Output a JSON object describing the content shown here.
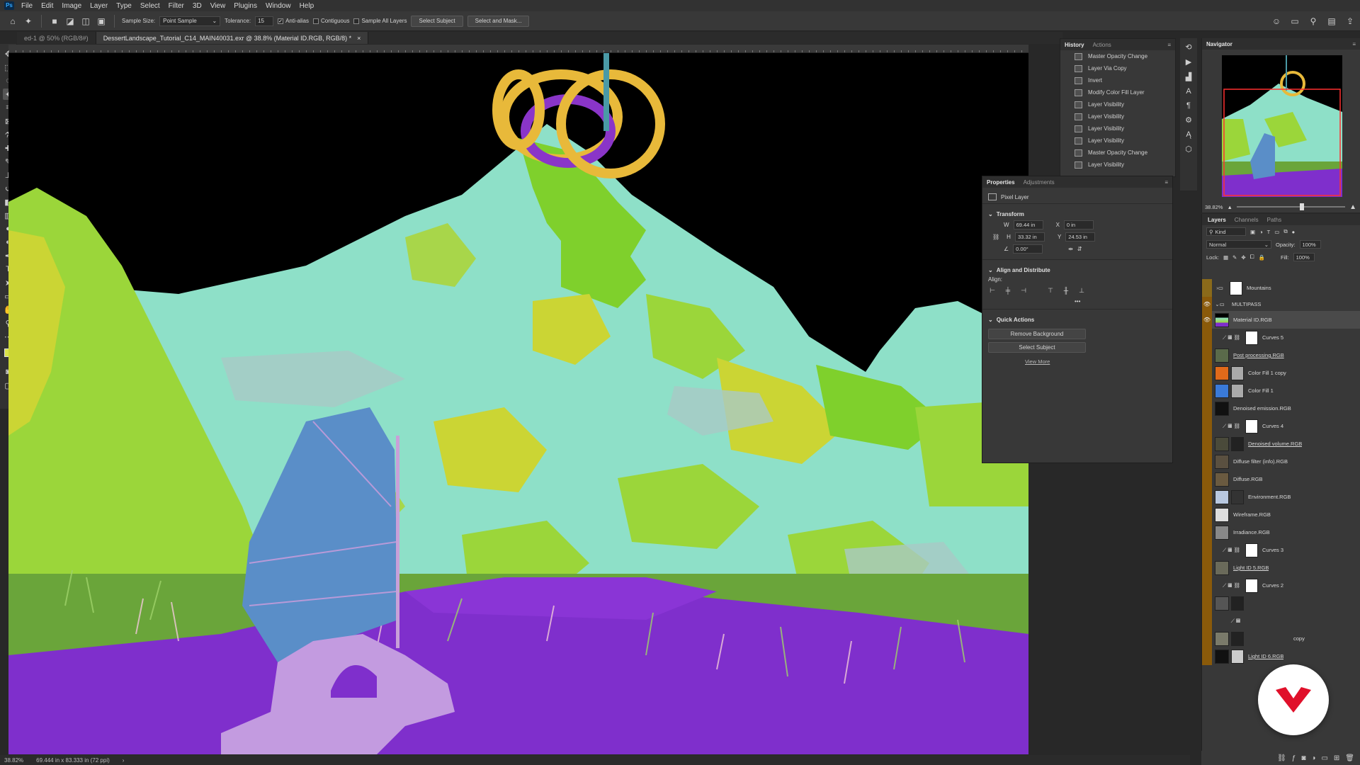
{
  "app": {
    "logo_text": "Ps"
  },
  "menu": [
    "File",
    "Edit",
    "Image",
    "Layer",
    "Type",
    "Select",
    "Filter",
    "3D",
    "View",
    "Plugins",
    "Window",
    "Help"
  ],
  "options": {
    "sample_size_label": "Sample Size:",
    "sample_size_value": "Point Sample",
    "tolerance_label": "Tolerance:",
    "tolerance_value": "15",
    "anti_alias": "Anti-alias",
    "contiguous": "Contiguous",
    "sample_all_layers": "Sample All Layers",
    "select_subject": "Select Subject",
    "select_and_mask": "Select and Mask..."
  },
  "tabs": [
    {
      "label": "ed-1 @ 50% (RGB/8#)"
    },
    {
      "label": "DessertLandscape_Tutorial_C14_MAIN40031.exr @ 38.8% (Material ID.RGB, RGB/8) *",
      "close": "×"
    }
  ],
  "status": {
    "zoom": "38.82%",
    "doc_size": "69.444 in x 83.333 in (72 ppi)",
    "arrow": "›"
  },
  "history": {
    "tabs": [
      "History",
      "Actions"
    ],
    "items": [
      "Master Opacity Change",
      "Layer Via Copy",
      "Invert",
      "Modify Color Fill Layer",
      "Layer Visibility",
      "Layer Visibility",
      "Layer Visibility",
      "Layer Visibility",
      "Master Opacity Change",
      "Layer Visibility"
    ]
  },
  "properties": {
    "tabs": [
      "Properties",
      "Adjustments"
    ],
    "kind": "Pixel Layer",
    "transform_title": "Transform",
    "w_label": "W",
    "w_value": "69.44 in",
    "h_label": "H",
    "h_value": "33.32 in",
    "x_label": "X",
    "x_value": "0 in",
    "y_label": "Y",
    "y_value": "24.53 in",
    "angle_value": "0.00°",
    "align_title": "Align and Distribute",
    "align_label": "Align:",
    "more": "•••",
    "quick_actions_title": "Quick Actions",
    "remove_background": "Remove Background",
    "select_subject": "Select Subject",
    "view_more": "View More"
  },
  "navigator": {
    "title": "Navigator",
    "zoom": "38.82%"
  },
  "layers": {
    "tabs": [
      "Layers",
      "Channels",
      "Paths"
    ],
    "kind_label": "Kind",
    "blend_mode": "Normal",
    "opacity_label": "Opacity:",
    "opacity_value": "100%",
    "lock_label": "Lock:",
    "fill_label": "Fill:",
    "fill_value": "100%",
    "rows": [
      {
        "name": "Mountains"
      },
      {
        "name": "MULTIPASS"
      },
      {
        "name": "Material ID.RGB"
      },
      {
        "name": "Curves 5"
      },
      {
        "name": "Post processing.RGB"
      },
      {
        "name": "Color Fill 1 copy"
      },
      {
        "name": "Color Fill 1"
      },
      {
        "name": "Denoised emission.RGB"
      },
      {
        "name": "Curves 4"
      },
      {
        "name": "Denoised volume.RGB"
      },
      {
        "name": "Diffuse filter (info).RGB"
      },
      {
        "name": "Diffuse.RGB"
      },
      {
        "name": "Environment.RGB"
      },
      {
        "name": "Wireframe.RGB"
      },
      {
        "name": "Irradiance.RGB"
      },
      {
        "name": "Curves 3"
      },
      {
        "name": "Light ID 5.RGB"
      },
      {
        "name": "Curves 2"
      },
      {
        "name": ""
      },
      {
        "name": ""
      },
      {
        "name": "copy"
      },
      {
        "name": "Light ID 6.RGB"
      }
    ]
  }
}
